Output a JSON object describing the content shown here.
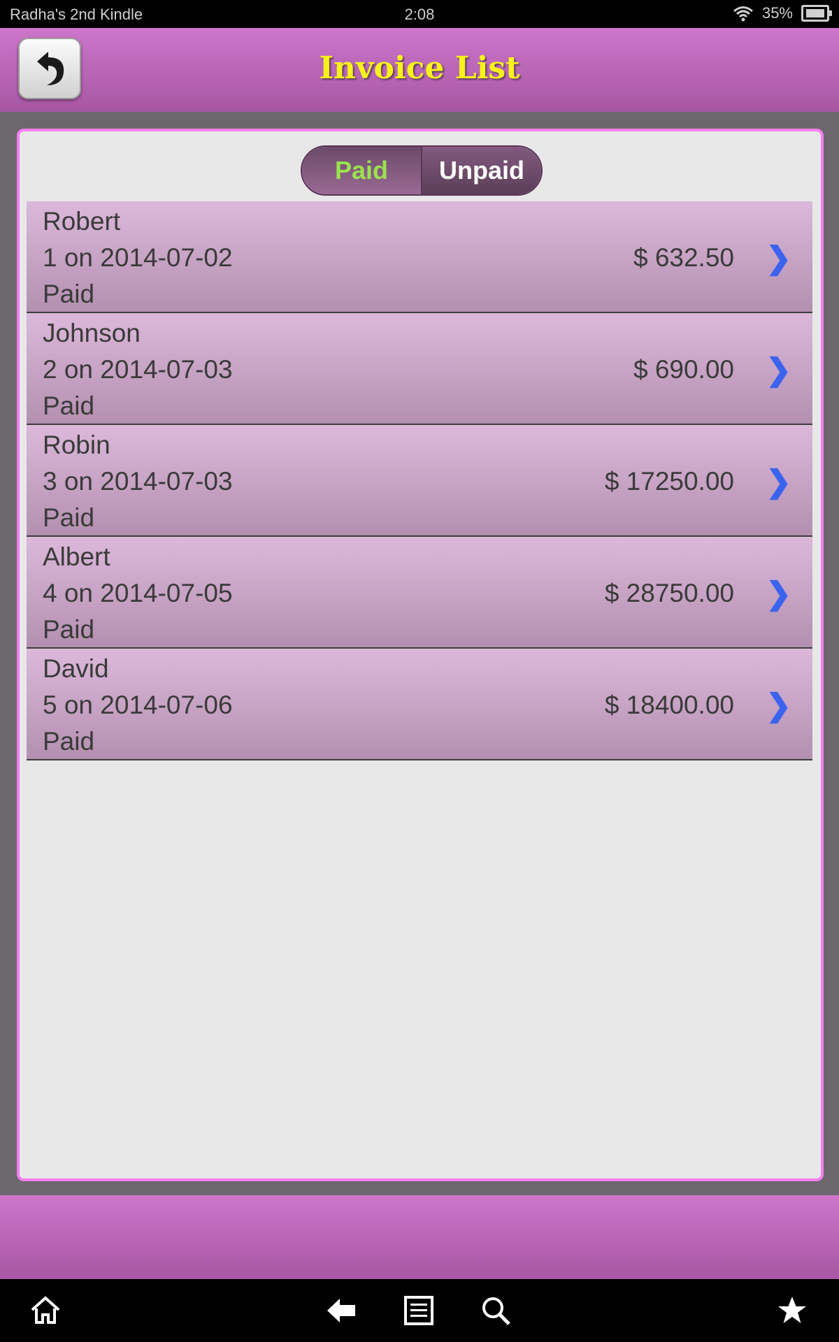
{
  "status_bar": {
    "device_name": "Radha's 2nd Kindle",
    "time": "2:08",
    "battery": "35%"
  },
  "header": {
    "title": "Invoice List",
    "back_icon": "back-arrow-icon"
  },
  "filter": {
    "paid_label": "Paid",
    "unpaid_label": "Unpaid",
    "selected": "Paid"
  },
  "invoices": [
    {
      "name": "Robert",
      "info": "1 on 2014-07-02",
      "status": "Paid",
      "amount": "$ 632.50"
    },
    {
      "name": "Johnson",
      "info": "2 on 2014-07-03",
      "status": "Paid",
      "amount": "$ 690.00"
    },
    {
      "name": "Robin",
      "info": "3 on 2014-07-03",
      "status": "Paid",
      "amount": "$ 17250.00"
    },
    {
      "name": "Albert",
      "info": "4 on 2014-07-05",
      "status": "Paid",
      "amount": "$ 28750.00"
    },
    {
      "name": "David",
      "info": "5 on 2014-07-06",
      "status": "Paid",
      "amount": "$ 18400.00"
    }
  ],
  "colors": {
    "header_top": "#cd76cb",
    "header_bottom": "#a757a3",
    "title": "#f6f21a",
    "paid_text": "#9be14e",
    "chevron": "#3b63f0",
    "panel_border": "#f47ef1"
  },
  "nav_icons": [
    "home-icon",
    "back-icon",
    "menu-icon",
    "search-icon",
    "favorites-icon"
  ]
}
